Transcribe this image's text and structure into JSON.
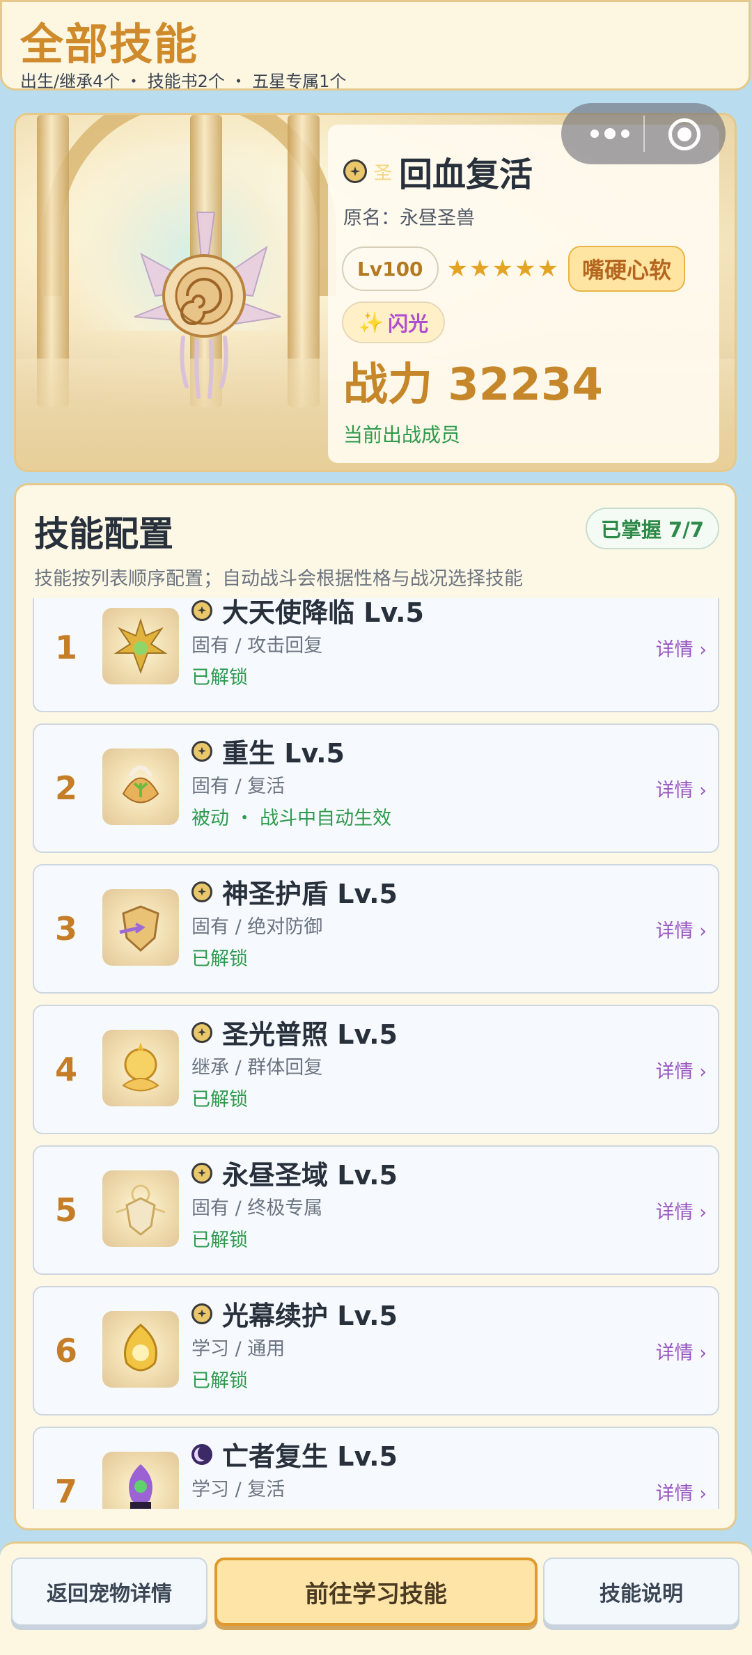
{
  "header": {
    "title": "全部技能",
    "subtitle": "出生/继承4个 ・ 技能书2个 ・ 五星专属1个"
  },
  "pet": {
    "holy_tag": "圣",
    "name": "回血复活",
    "origin": "原名：永昼圣兽",
    "level": "Lv100",
    "stars": "★★★★★",
    "nature": "嘴硬心软",
    "flash": "闪光",
    "flash_icon": "✨",
    "power": "战力 32234",
    "status": "当前出战成员"
  },
  "panel": {
    "title": "技能配置",
    "mastered": "已掌握 7/7",
    "hint": "技能按列表顺序配置；自动战斗会根据性格与战况选择技能"
  },
  "skills": [
    {
      "index": "1",
      "icon": "holy-star-icon",
      "name": "大天使降临  Lv.5",
      "type": "固有 / 攻击回复",
      "state": "已解锁",
      "detail": "详情 ›"
    },
    {
      "index": "2",
      "icon": "holy-star-icon",
      "name": "重生  Lv.5",
      "type": "固有 / 复活",
      "state": "被动 ・ 战斗中自动生效",
      "detail": "详情 ›"
    },
    {
      "index": "3",
      "icon": "holy-star-icon",
      "name": "神圣护盾  Lv.5",
      "type": "固有 / 绝对防御",
      "state": "已解锁",
      "detail": "详情 ›"
    },
    {
      "index": "4",
      "icon": "holy-star-icon",
      "name": "圣光普照  Lv.5",
      "type": "继承 / 群体回复",
      "state": "已解锁",
      "detail": "详情 ›"
    },
    {
      "index": "5",
      "icon": "holy-star-icon",
      "name": "永昼圣域  Lv.5",
      "type": "固有 / 终极专属",
      "state": "已解锁",
      "detail": "详情 ›"
    },
    {
      "index": "6",
      "icon": "holy-star-icon",
      "name": "光幕续护  Lv.5",
      "type": "学习 / 通用",
      "state": "已解锁",
      "detail": "详情 ›"
    },
    {
      "index": "7",
      "icon": "dark-moon-icon",
      "name": "亡者复生  Lv.5",
      "type": "学习 / 复活",
      "state": "",
      "detail": "详情 ›"
    }
  ],
  "bottom": {
    "back": "返回宠物详情",
    "learn": "前往学习技能",
    "help": "技能说明"
  },
  "colors": {
    "accent_gold": "#cf8a2c",
    "unlocked_green": "#2e9a4c",
    "detail_purple": "#9a55c0"
  }
}
